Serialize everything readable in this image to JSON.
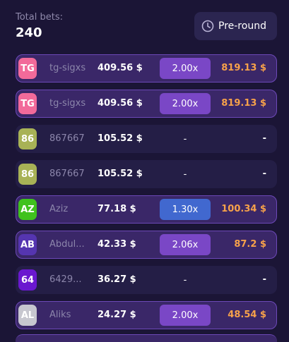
{
  "header": {
    "total_label": "Total bets:",
    "total_value": "240",
    "preround_label": "Pre-round"
  },
  "rows": [
    {
      "avatar": "TG",
      "avatar_color": "#f26a9a",
      "name": "tg-sigxs",
      "bet": "409.56 $",
      "multiplier": "2.00x",
      "mult_style": "purple",
      "payout": "819.13 $",
      "status": "win"
    },
    {
      "avatar": "TG",
      "avatar_color": "#f26a9a",
      "name": "tg-sigxs",
      "bet": "409.56 $",
      "multiplier": "2.00x",
      "mult_style": "purple",
      "payout": "819.13 $",
      "status": "win"
    },
    {
      "avatar": "86",
      "avatar_color": "#a8b256",
      "name": "867667",
      "bet": "105.52 $",
      "multiplier": "-",
      "mult_style": "none",
      "payout": "-",
      "status": "lose"
    },
    {
      "avatar": "86",
      "avatar_color": "#a8b256",
      "name": "867667",
      "bet": "105.52 $",
      "multiplier": "-",
      "mult_style": "none",
      "payout": "-",
      "status": "lose"
    },
    {
      "avatar": "AZ",
      "avatar_color": "#3fc21d",
      "name": "Aziz",
      "bet": "77.18 $",
      "multiplier": "1.30x",
      "mult_style": "blue",
      "payout": "100.34 $",
      "status": "win"
    },
    {
      "avatar": "AB",
      "avatar_color": "#5535b0",
      "name": "Abdul...",
      "bet": "42.33 $",
      "multiplier": "2.06x",
      "mult_style": "purple",
      "payout": "87.2 $",
      "status": "win"
    },
    {
      "avatar": "64",
      "avatar_color": "#6a18cf",
      "name": "6429...",
      "bet": "36.27 $",
      "multiplier": "-",
      "mult_style": "none",
      "payout": "-",
      "status": "lose"
    },
    {
      "avatar": "AL",
      "avatar_color": "#c7c7cf",
      "name": "Aliks",
      "bet": "24.27 $",
      "multiplier": "2.00x",
      "mult_style": "purple",
      "payout": "48.54 $",
      "status": "win"
    }
  ],
  "icons": {
    "preround": "clock-icon"
  },
  "colors": {
    "background": "#1b1536",
    "win_row": "#3a2768",
    "lose_row": "#241e46",
    "payout_win": "#f7a24a"
  }
}
